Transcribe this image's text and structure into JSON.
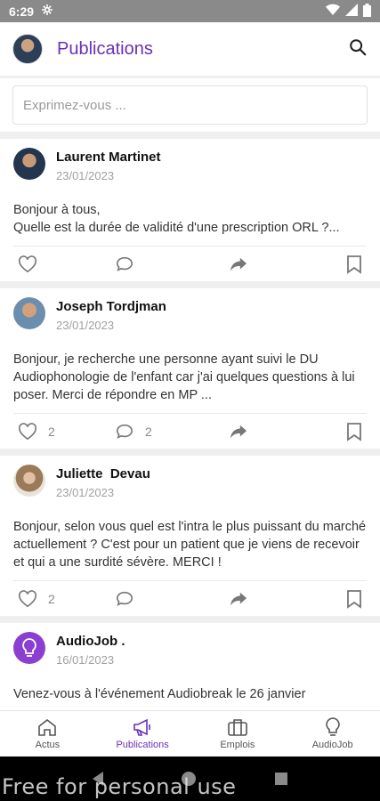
{
  "status": {
    "time": "6:29"
  },
  "header": {
    "title": "Publications"
  },
  "composer": {
    "placeholder": "Exprimez-vous ..."
  },
  "posts": [
    {
      "author": "Laurent Martinet",
      "date": "23/01/2023",
      "body": "Bonjour à tous,\nQuelle est la durée de validité d'une prescription ORL ?...",
      "likes": "",
      "comments": ""
    },
    {
      "author": "Joseph Tordjman",
      "date": "23/01/2023",
      "body": "Bonjour, je recherche une personne ayant suivi le DU Audiophonologie de l'enfant car j'ai quelques questions à lui poser. Merci de répondre en MP ...",
      "likes": "2",
      "comments": "2"
    },
    {
      "author": "Juliette  Devau",
      "date": "23/01/2023",
      "body": "Bonjour, selon vous quel est l'intra le plus puissant du marché actuellement ? C'est pour un patient que je viens de recevoir et qui a une surdité sévère. MERCI !",
      "likes": "2",
      "comments": ""
    },
    {
      "author": "AudioJob .",
      "date": "16/01/2023",
      "body": "Venez-vous à l'événement Audiobreak le 26 janvier",
      "likes": "",
      "comments": ""
    }
  ],
  "nav": [
    {
      "label": "Actus",
      "icon": "home-icon"
    },
    {
      "label": "Publications",
      "icon": "megaphone-icon"
    },
    {
      "label": "Emplois",
      "icon": "briefcase-icon"
    },
    {
      "label": "AudioJob",
      "icon": "bulb-icon"
    }
  ],
  "colors": {
    "accent": "#6b2fb8",
    "statusbar": "#8a8a8a"
  },
  "watermark": "Free for personal use"
}
